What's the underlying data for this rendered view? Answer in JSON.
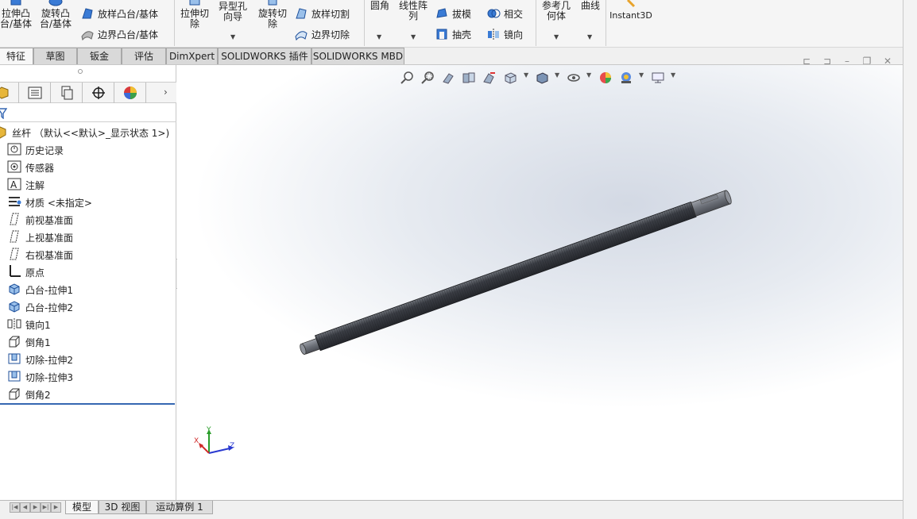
{
  "ribbon": {
    "extrude_boss": "拉伸凸\n台/基体",
    "revolve_boss": "旋转凸\n台/基体",
    "loft_boss": "放样凸台/基体",
    "boundary_boss": "边界凸台/基体",
    "extrude_cut": "拉伸切\n除",
    "hole_wizard": "异型孔\n向导",
    "revolve_cut": "旋转切\n除",
    "loft_cut": "放样切割",
    "boundary_cut": "边界切除",
    "fillet": "圆角",
    "linear_pattern": "线性阵\n列",
    "draft": "拔模",
    "shell": "抽壳",
    "intersect": "相交",
    "mirror": "镜向",
    "ref_geometry": "参考几\n何体",
    "curves": "曲线",
    "instant3d": "Instant3D"
  },
  "tabs": [
    "特征",
    "草图",
    "钣金",
    "评估",
    "DimXpert",
    "SOLIDWORKS 插件",
    "SOLIDWORKS MBD"
  ],
  "active_tab": "特征",
  "tree": {
    "root": "丝杆 （默认<<默认>_显示状态 1>)",
    "items": [
      {
        "label": "历史记录",
        "icon": "history-icon"
      },
      {
        "label": "传感器",
        "icon": "sensor-icon"
      },
      {
        "label": "注解",
        "icon": "annotation-icon"
      },
      {
        "label": "材质 <未指定>",
        "icon": "material-icon"
      },
      {
        "label": "前视基准面",
        "icon": "plane-icon"
      },
      {
        "label": "上视基准面",
        "icon": "plane-icon"
      },
      {
        "label": "右视基准面",
        "icon": "plane-icon"
      },
      {
        "label": "原点",
        "icon": "origin-icon"
      },
      {
        "label": "凸台-拉伸1",
        "icon": "extrude-icon"
      },
      {
        "label": "凸台-拉伸2",
        "icon": "extrude-icon"
      },
      {
        "label": "镜向1",
        "icon": "mirror-icon"
      },
      {
        "label": "倒角1",
        "icon": "chamfer-icon"
      },
      {
        "label": "切除-拉伸2",
        "icon": "cut-extrude-icon"
      },
      {
        "label": "切除-拉伸3",
        "icon": "cut-extrude-icon"
      },
      {
        "label": "倒角2",
        "icon": "chamfer-icon"
      }
    ]
  },
  "triad": {
    "x": "X",
    "y": "Y",
    "z": "Z"
  },
  "bottom_tabs": [
    "模型",
    "3D 视图",
    "运动算例 1"
  ],
  "active_bottom_tab": "模型",
  "colors": {
    "accent": "#3567b2",
    "rod": "#4a4d55",
    "background": "#ffffff"
  }
}
